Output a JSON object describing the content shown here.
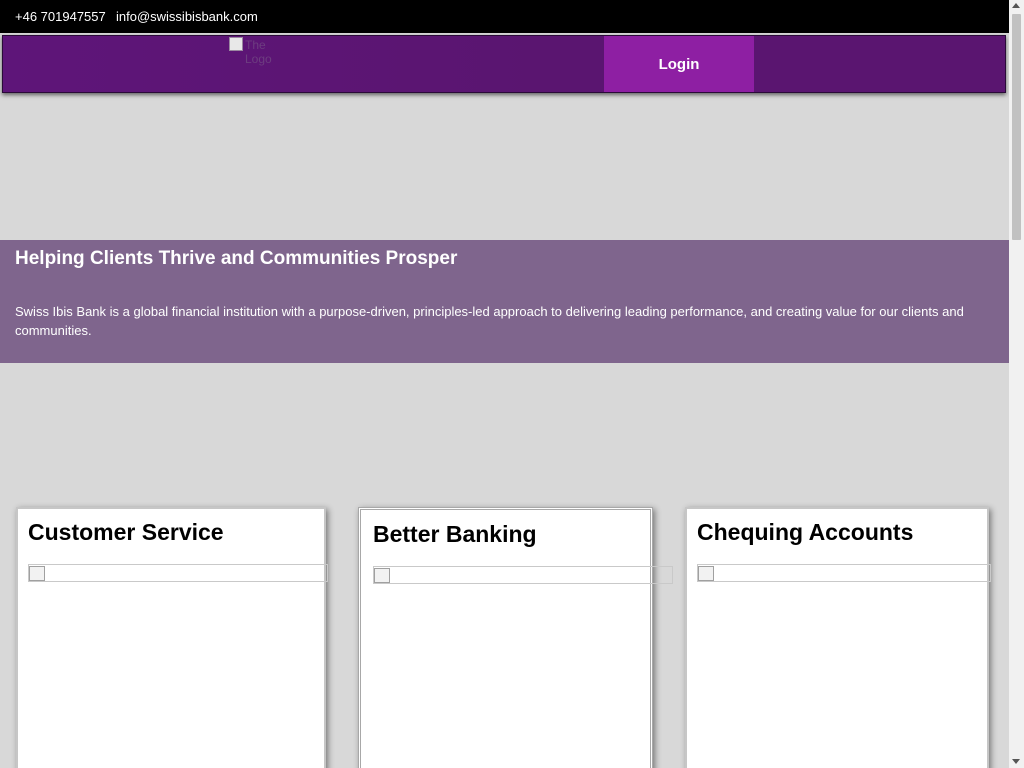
{
  "topbar": {
    "phone": "+46 701947557",
    "email": "info@swissibisbank.com"
  },
  "navbar": {
    "logo_alt": "The Logo",
    "login_label": "Login"
  },
  "hero": {
    "title": "Helping Clients Thrive and Communities Prosper",
    "description": "Swiss Ibis Bank is a global financial institution with a purpose-driven, principles-led approach to delivering leading performance, and creating value for our clients and communities."
  },
  "cards": [
    {
      "title": "Customer Service"
    },
    {
      "title": "Better Banking"
    },
    {
      "title": "Chequing Accounts"
    }
  ],
  "colors": {
    "topbar_bg": "#000000",
    "navbar_bg": "#5a1570",
    "login_bg": "#8e1fa3",
    "hero_bg": "#7f658d",
    "page_bg": "#d8d8d8"
  }
}
